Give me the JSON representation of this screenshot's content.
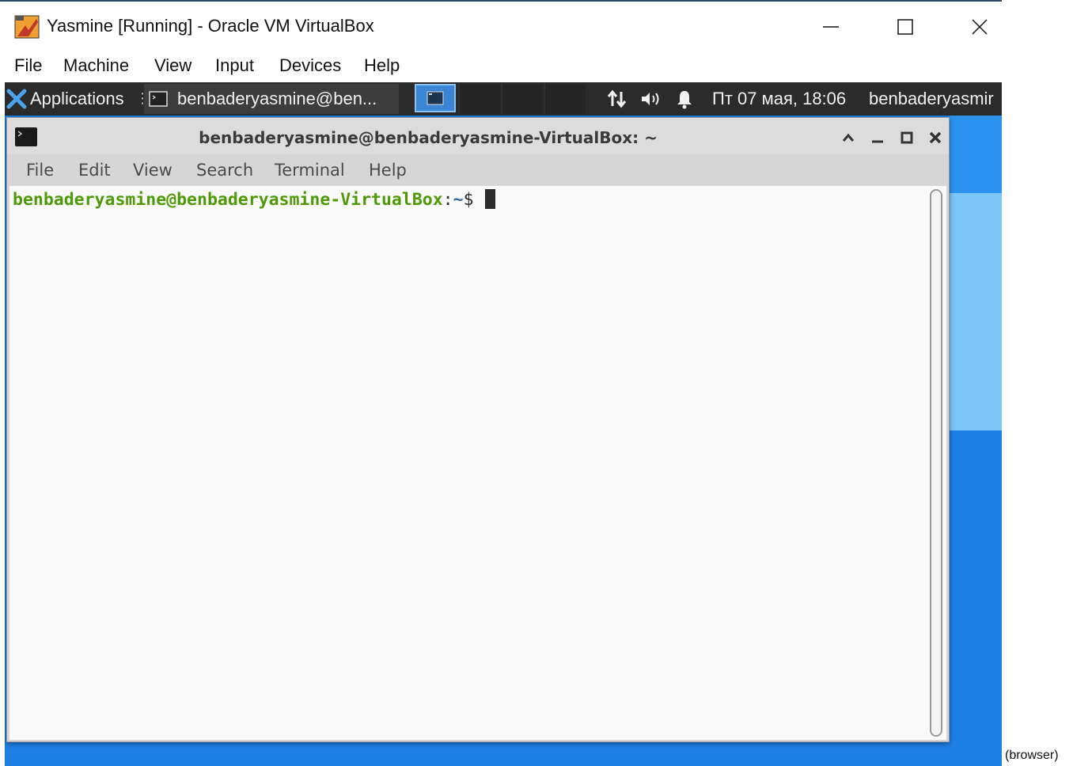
{
  "host": {
    "title": "Yasmine [Running] - Oracle VM VirtualBox",
    "menu": [
      "File",
      "Machine",
      "View",
      "Input",
      "Devices",
      "Help"
    ],
    "controls": {
      "minimize": "minimize-icon",
      "maximize": "maximize-icon",
      "close": "close-icon"
    }
  },
  "panel": {
    "applications_label": "Applications",
    "separator": "⋮",
    "task_label": "benbaderyasmine@ben...",
    "clock": "Пт 07 мая, 18:06",
    "user": "benbaderyasmir",
    "tray_icons": [
      "network-icon",
      "volume-icon",
      "notification-bell-icon"
    ]
  },
  "terminal": {
    "title": "benbaderyasmine@benbaderyasmine-VirtualBox: ~",
    "menu": [
      "File",
      "Edit",
      "View",
      "Search",
      "Terminal",
      "Help"
    ],
    "prompt_user": "benbaderyasmine@benbaderyasmine-VirtualBox",
    "prompt_sep": ":",
    "prompt_dir": "~",
    "prompt_symbol": "$"
  },
  "footer_label": "(browser)",
  "colors": {
    "desktop": "#1e7fe6",
    "panel": "#2b2b2b",
    "prompt_user": "#4e9a06",
    "prompt_dir": "#3465a4",
    "workspace_active": "#3a85d4"
  }
}
